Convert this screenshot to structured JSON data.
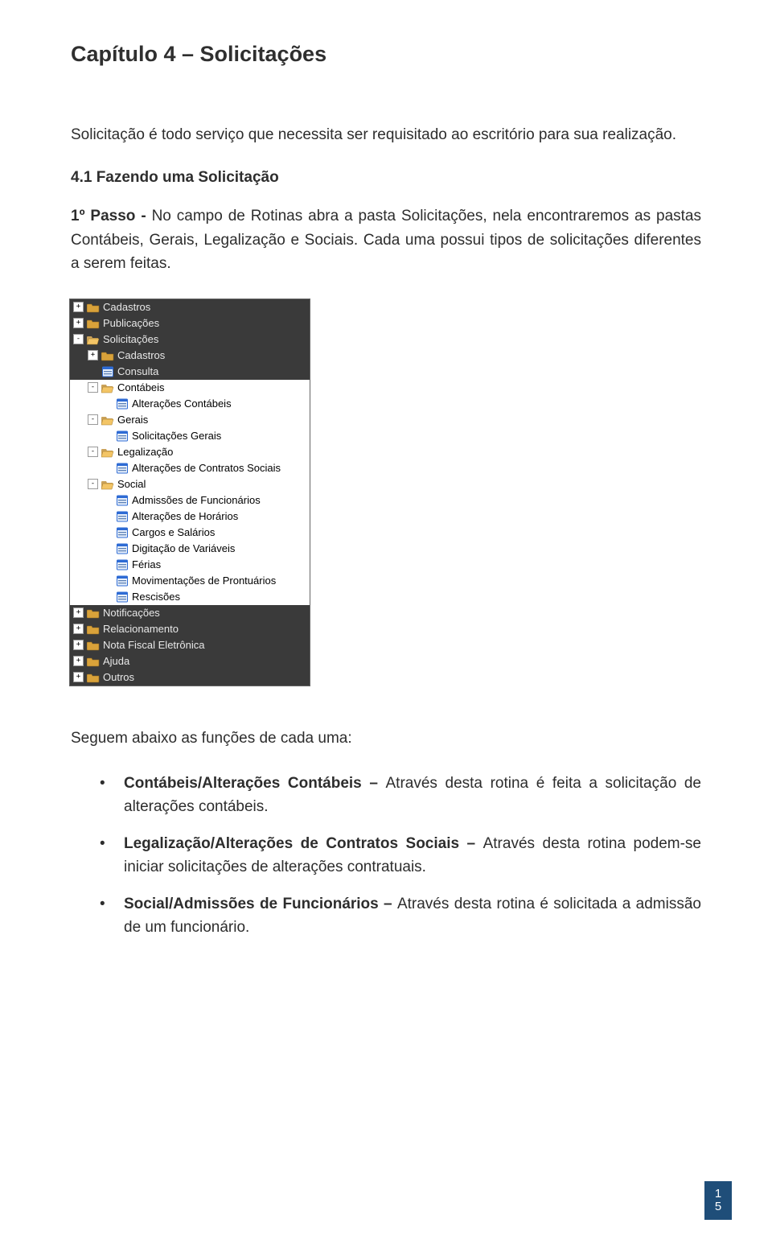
{
  "chapter": {
    "title": "Capítulo 4 – Solicitações"
  },
  "intro": {
    "text": "Solicitação é todo serviço que necessita ser requisitado ao escritório para sua realização."
  },
  "section": {
    "heading": "4.1 Fazendo uma Solicitação",
    "passo_label": "1º Passo - ",
    "passo_text_a": "No campo de Rotinas abra a pasta Solicitações, nela encontraremos as pastas Contábeis, Gerais, Legalização e Sociais. Cada uma possui tipos de solicitações diferentes a serem feitas."
  },
  "tree": {
    "items": [
      {
        "indent": 0,
        "toggle": "+",
        "icon": "folder-closed",
        "label": "Cadastros",
        "selected": false
      },
      {
        "indent": 0,
        "toggle": "+",
        "icon": "folder-closed",
        "label": "Publicações",
        "selected": false
      },
      {
        "indent": 0,
        "toggle": "-",
        "icon": "folder-open",
        "label": "Solicitações",
        "selected": false
      },
      {
        "indent": 1,
        "toggle": "+",
        "icon": "folder-closed",
        "label": "Cadastros",
        "selected": false
      },
      {
        "indent": 1,
        "toggle": "",
        "icon": "form",
        "label": "Consulta",
        "selected": false
      },
      {
        "indent": 1,
        "toggle": "-",
        "icon": "folder-open",
        "label": "Contábeis",
        "selected": true
      },
      {
        "indent": 2,
        "toggle": "",
        "icon": "form",
        "label": "Alterações Contábeis",
        "selected": true
      },
      {
        "indent": 1,
        "toggle": "-",
        "icon": "folder-open",
        "label": "Gerais",
        "selected": true
      },
      {
        "indent": 2,
        "toggle": "",
        "icon": "form",
        "label": "Solicitações Gerais",
        "selected": true
      },
      {
        "indent": 1,
        "toggle": "-",
        "icon": "folder-open",
        "label": "Legalização",
        "selected": true
      },
      {
        "indent": 2,
        "toggle": "",
        "icon": "form",
        "label": "Alterações de Contratos Sociais",
        "selected": true
      },
      {
        "indent": 1,
        "toggle": "-",
        "icon": "folder-open",
        "label": "Social",
        "selected": true
      },
      {
        "indent": 2,
        "toggle": "",
        "icon": "form",
        "label": "Admissões de Funcionários",
        "selected": true
      },
      {
        "indent": 2,
        "toggle": "",
        "icon": "form",
        "label": "Alterações de Horários",
        "selected": true
      },
      {
        "indent": 2,
        "toggle": "",
        "icon": "form",
        "label": "Cargos e Salários",
        "selected": true
      },
      {
        "indent": 2,
        "toggle": "",
        "icon": "form",
        "label": "Digitação de Variáveis",
        "selected": true
      },
      {
        "indent": 2,
        "toggle": "",
        "icon": "form",
        "label": "Férias",
        "selected": true
      },
      {
        "indent": 2,
        "toggle": "",
        "icon": "form",
        "label": "Movimentações de Prontuários",
        "selected": true
      },
      {
        "indent": 2,
        "toggle": "",
        "icon": "form",
        "label": "Rescisões",
        "selected": true
      },
      {
        "indent": 0,
        "toggle": "+",
        "icon": "folder-closed",
        "label": "Notificações",
        "selected": false
      },
      {
        "indent": 0,
        "toggle": "+",
        "icon": "folder-closed",
        "label": "Relacionamento",
        "selected": false
      },
      {
        "indent": 0,
        "toggle": "+",
        "icon": "folder-closed",
        "label": "Nota Fiscal Eletrônica",
        "selected": false
      },
      {
        "indent": 0,
        "toggle": "+",
        "icon": "folder-closed",
        "label": "Ajuda",
        "selected": false
      },
      {
        "indent": 0,
        "toggle": "+",
        "icon": "folder-closed",
        "label": "Outros",
        "selected": false
      }
    ]
  },
  "functions": {
    "lead": "Seguem abaixo as funções de cada uma:",
    "items": [
      {
        "title": "Contábeis/Alterações Contábeis – ",
        "desc": "Através desta rotina é feita a solicitação de alterações contábeis."
      },
      {
        "title": "Legalização/Alterações de Contratos Sociais – ",
        "desc": "Através desta rotina podem-se iniciar solicitações de alterações contratuais."
      },
      {
        "title": "Social/Admissões de Funcionários – ",
        "desc": "Através desta rotina é solicitada a admissão de um funcionário."
      }
    ]
  },
  "page_number": {
    "a": "1",
    "b": "5"
  },
  "icons": {
    "folder_closed_svg": "<svg width='16' height='14' viewBox='0 0 16 14'><path d='M1 3h5l1 2h8v7a1 1 0 0 1-1 1H1a1 1 0 0 1-1-1V4a1 1 0 0 1 1-1z' fill='#d9a23a' stroke='#8a651f' stroke-width='0.6'/></svg>",
    "folder_open_svg": "<svg width='16' height='14' viewBox='0 0 16 14'><path d='M1 3h5l1 2h7v1H2L0 12V4a1 1 0 0 1 1-1z' fill='#caa25a'/><path d='M2 6h13l-2 7H0z' fill='#f3c566' stroke='#a37826' stroke-width='0.5'/></svg>",
    "form_svg": "<svg width='16' height='14' viewBox='0 0 16 14'><rect x='1.5' y='1' width='13' height='12' rx='1' fill='#e8f0fb' stroke='#2e6bd4' stroke-width='1'/><rect x='1.5' y='1' width='13' height='3' fill='#2e6bd4'/><rect x='3' y='6' width='10' height='1.3' fill='#5a7fb5'/><rect x='3' y='9' width='10' height='1.3' fill='#5a7fb5'/></svg>"
  }
}
